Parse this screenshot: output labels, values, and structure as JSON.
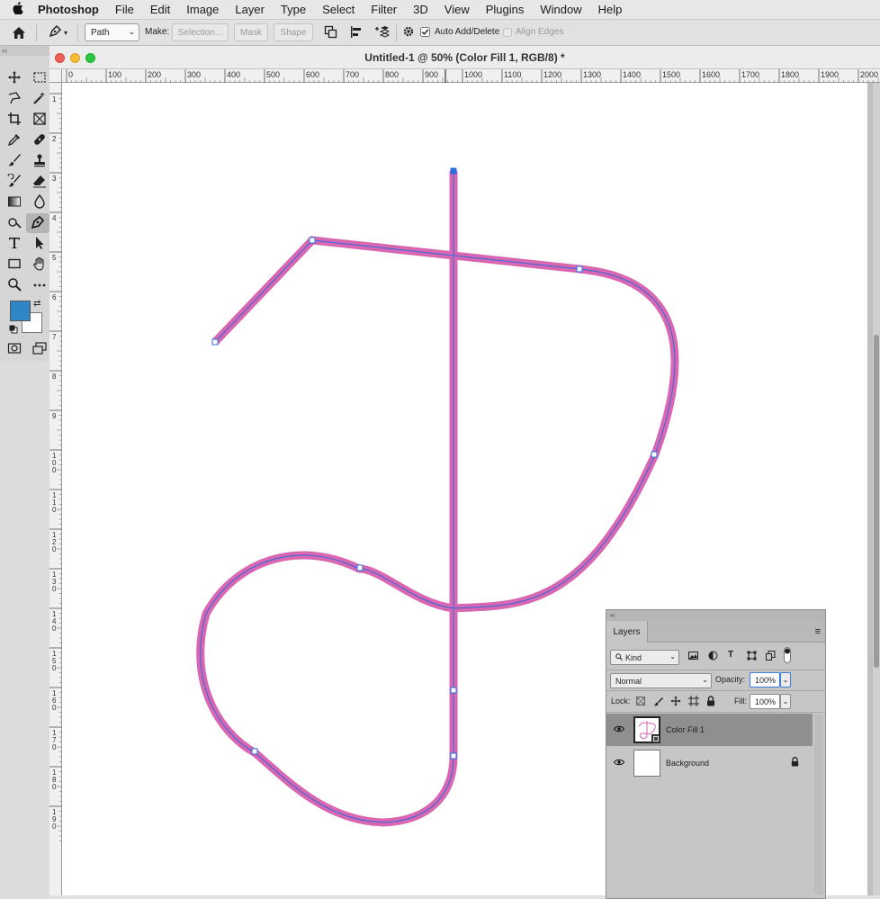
{
  "menubar": {
    "apple": "",
    "app": "Photoshop",
    "items": [
      "File",
      "Edit",
      "Image",
      "Layer",
      "Type",
      "Select",
      "Filter",
      "3D",
      "View",
      "Plugins",
      "Window",
      "Help"
    ]
  },
  "options": {
    "mode_value": "Path",
    "make_label": "Make:",
    "selection_label": "Selection...",
    "mask_label": "Mask",
    "shape_label": "Shape",
    "auto_add_delete_label": "Auto Add/Delete",
    "auto_add_delete_checked": true,
    "align_edges_label": "Align Edges"
  },
  "toolbar": {
    "collapse": "‹‹",
    "foreground_color": "#2f86c6",
    "background_color": "#ffffff",
    "active_tool": "pen-tool"
  },
  "document": {
    "title": "Untitled-1 @ 50% (Color Fill 1, RGB/8) *",
    "ruler_ticks": [
      "0",
      "100",
      "200",
      "300",
      "400",
      "500",
      "600",
      "700",
      "800",
      "900",
      "1000",
      "1100",
      "1200",
      "1300",
      "1400",
      "1500",
      "1600",
      "1700",
      "1800",
      "1900",
      "2000"
    ],
    "vruler_ticks": [
      "1",
      "2",
      "3",
      "4",
      "5",
      "6",
      "7",
      "8",
      "9",
      "1\n0\n0",
      "1\n1\n0",
      "1\n2\n0",
      "1\n3\n0",
      "1\n4\n0",
      "1\n5\n0",
      "1\n6\n0",
      "1\n7\n0",
      "1\n8\n0",
      "1\n9\n0"
    ],
    "stroke_color": "#d966b0",
    "path_color": "#2b6de0"
  },
  "layers": {
    "collapse": "‹‹",
    "tab": "Layers",
    "menu_icon": "≡",
    "filter_value": "Kind",
    "blend_value": "Normal",
    "opacity_label": "Opacity:",
    "opacity_value": "100%",
    "lock_label": "Lock:",
    "fill_label": "Fill:",
    "fill_value": "100%",
    "items": [
      {
        "name": "Color Fill 1",
        "selected": true,
        "locked": false
      },
      {
        "name": "Background",
        "selected": false,
        "locked": true
      }
    ]
  }
}
